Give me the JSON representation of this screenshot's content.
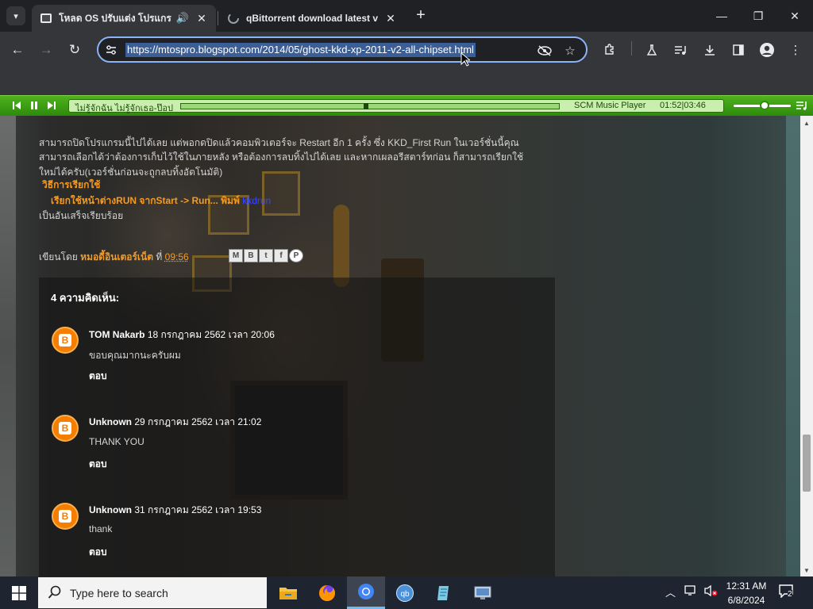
{
  "browser": {
    "tabs": [
      {
        "title": "โหลด OS ปรับแต่ง โปรแกรมลอง",
        "active": true,
        "audio": true
      },
      {
        "title": "qBittorrent download latest ve",
        "active": false,
        "audio": false
      }
    ],
    "new_tab_symbol": "+",
    "address": "https://mtospro.blogspot.com/2014/05/ghost-kkd-xp-2011-v2-all-chipset.html",
    "window_controls": {
      "minimize": "—",
      "maximize": "❐",
      "close": "✕"
    }
  },
  "music_player": {
    "song": "ไม่รู้จักฉัน ไม่รู้จักเธอ-ป๊อป",
    "player_name": "SCM Music Player",
    "time": "01:52|03:46",
    "progress_fraction": 0.49,
    "volume_fraction": 0.55
  },
  "post": {
    "paragraph_lines": [
      "สามารถปิดโปรแกรมนี้ไปได้เลย แต่พอกดปิดแล้วคอมพิวเตอร์จะ Restart  อีก 1 ครั้ง ซึ่ง KKD_First Run ในเวอร์ชั่นนี้คุณ",
      "สามารถเลือกได้ว่าต้องการเก็บไว้ใช้ในภายหลัง หรือต้องการลบทิ้งไปได้เลย และหากเผลอรีสตาร์ทก่อน ก็สามารถเรียกใช้",
      "ใหม่ได้ครับ(เวอร์ชั่นก่อนจะถูกลบทิ้งอัตโนมัติ)"
    ],
    "howto_heading": "วิธีการเรียกใช้",
    "run_instruction": "เรียกใช้หน้าต่างRUN จากStart -> Run... พิมพ์ ",
    "run_command": "kkdrun",
    "done_text": "เป็นอันเสร็จเรียบร้อย",
    "posted_by_label": "เขียนโดย",
    "author": "หมอดี้อินเตอร์เน็ต",
    "at_label": "ที่",
    "post_time": "09:56",
    "share_buttons": [
      "M",
      "B",
      "t",
      "f",
      "P"
    ]
  },
  "comments": {
    "heading": "4 ความคิดเห็น:",
    "reply_label": "ตอบ",
    "items": [
      {
        "author": "TOM Nakarb",
        "date": "18 กรกฎาคม 2562 เวลา 20:06",
        "text": "ขอบคุณมากนะครับผม"
      },
      {
        "author": "Unknown",
        "date": "29 กรกฎาคม 2562 เวลา 21:02",
        "text": "THANK YOU"
      },
      {
        "author": "Unknown",
        "date": "31 กรกฎาคม 2562 เวลา 19:53",
        "text": "thank"
      }
    ]
  },
  "taskbar": {
    "search_placeholder": "Type here to search",
    "time": "12:31 AM",
    "date": "6/8/2024",
    "notification_count": "2"
  },
  "colors": {
    "accent_orange": "#f59a23",
    "player_green": "#3a9d14",
    "omnibox_focus": "#8ab4f8"
  }
}
